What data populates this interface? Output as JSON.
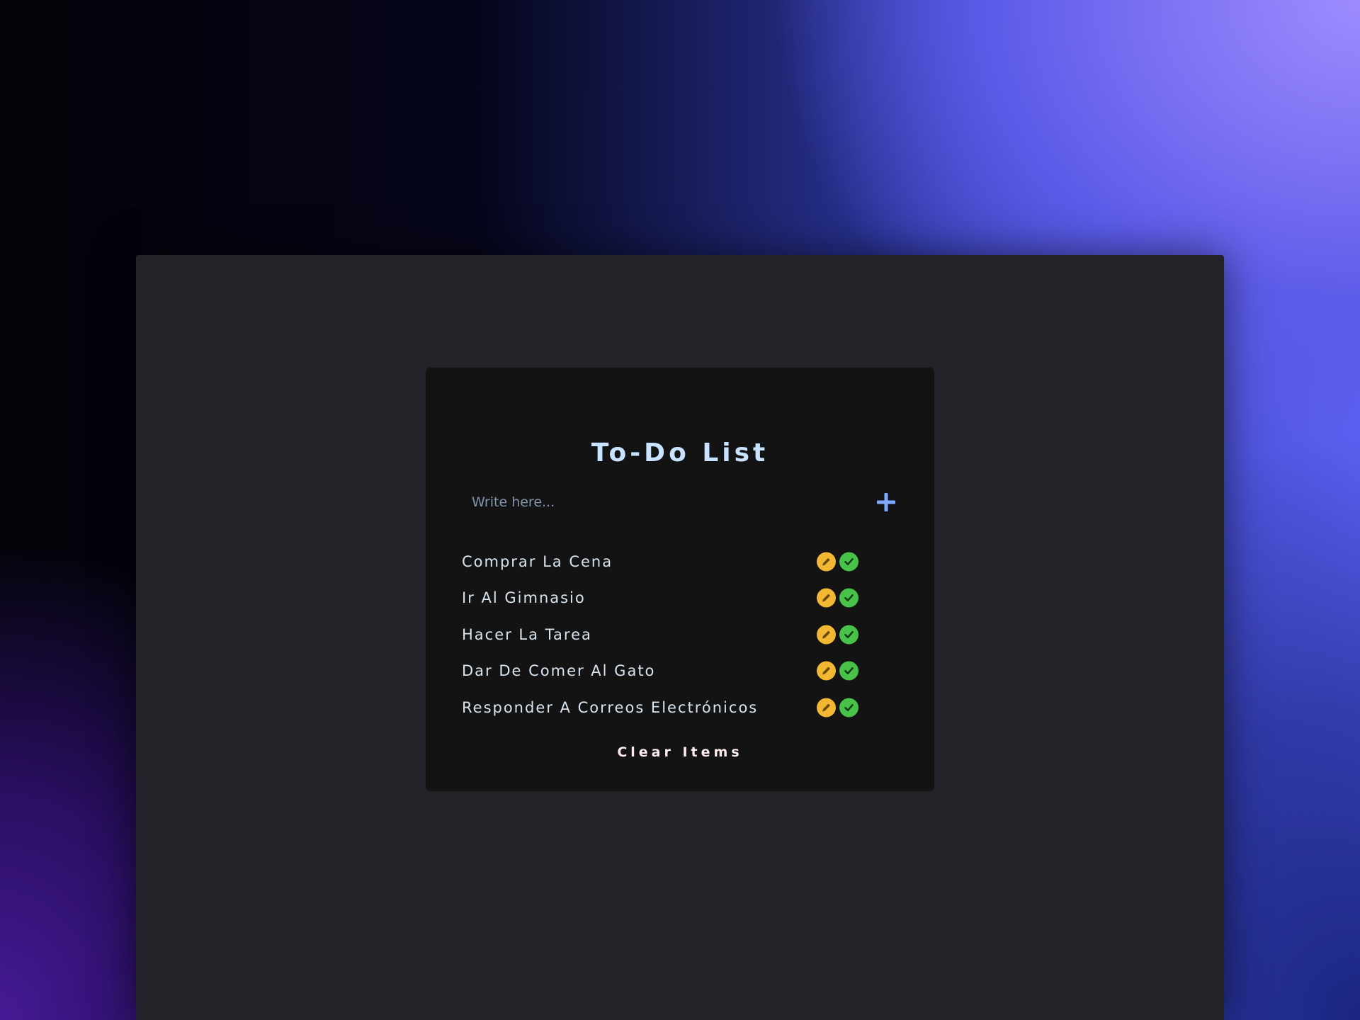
{
  "app": {
    "title": "To-Do List"
  },
  "input": {
    "placeholder": "Write here...",
    "value": ""
  },
  "add_button": {
    "icon": "plus-icon",
    "color": "#7fa8ff"
  },
  "tasks": [
    {
      "label": "Comprar La Cena"
    },
    {
      "label": "Ir Al Gimnasio"
    },
    {
      "label": "Hacer La Tarea"
    },
    {
      "label": "Dar De Comer Al Gato"
    },
    {
      "label": "Responder A Correos Electrónicos"
    }
  ],
  "task_actions": {
    "edit_icon": "pencil-icon",
    "edit_color": "#f2b833",
    "done_icon": "check-icon",
    "done_color": "#49c24a"
  },
  "clear_button": {
    "label": "Clear Items"
  },
  "colors": {
    "window_bg": "#222328",
    "card_bg": "#131314",
    "title": "#c8e3ff",
    "task_text": "#d6e4ef"
  }
}
